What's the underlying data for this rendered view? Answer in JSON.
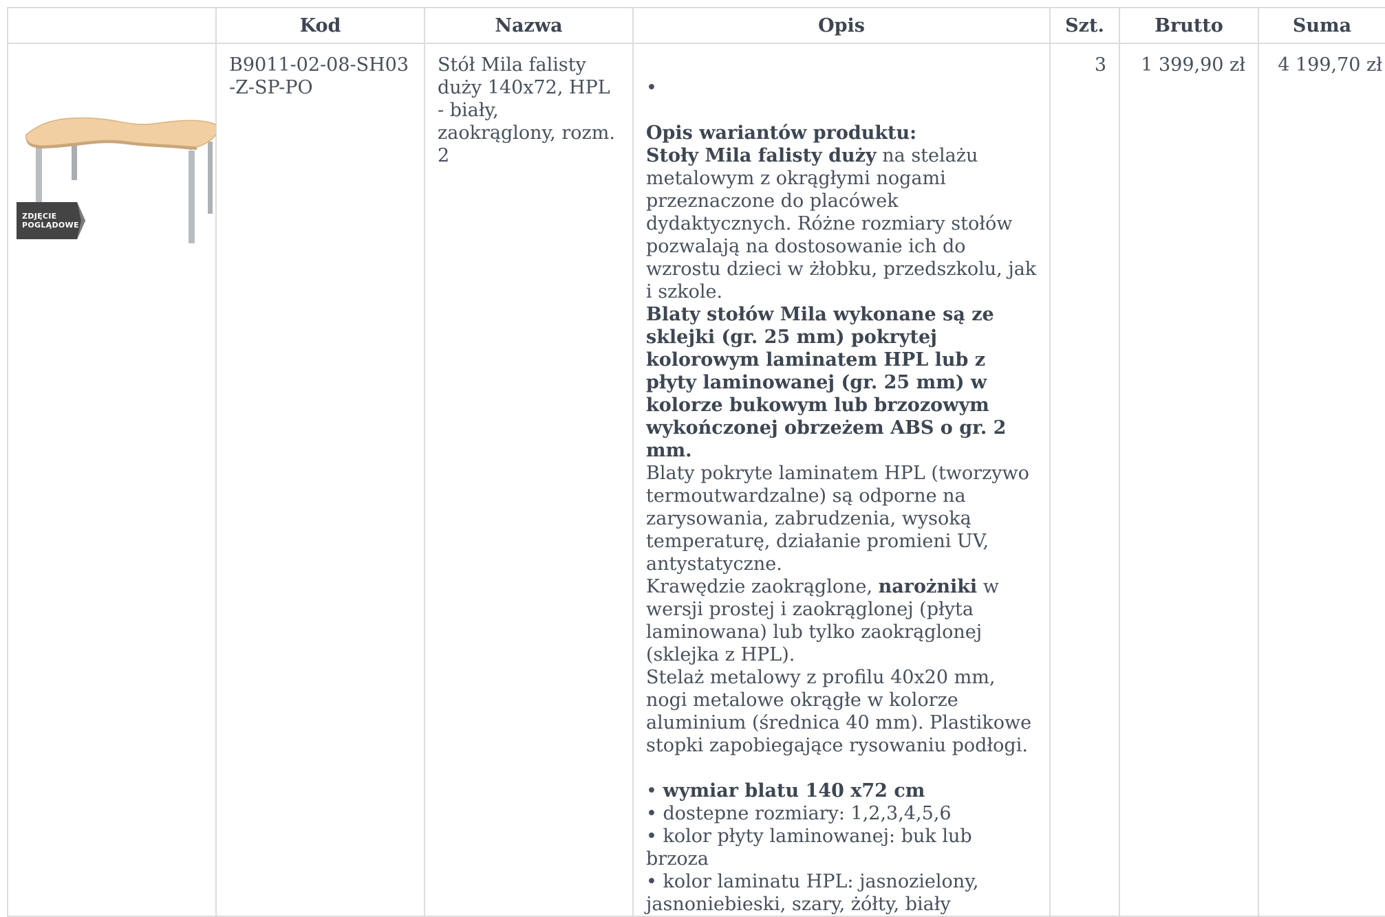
{
  "table": {
    "headers": [
      "",
      "Kod",
      "Nazwa",
      "Opis",
      "Szt.",
      "Brutto",
      "Suma"
    ],
    "row": {
      "image_badge": [
        "ZDJĘCIE",
        "POGLĄDOWE"
      ],
      "code": "B9011-02-08-SH03-Z-SP-PO",
      "name": "Stół Mila falisty duży 140x72, HPL - biały, zaokrąglony, rozm. 2",
      "qty": "3",
      "gross": "1 399,90 zł",
      "total": "4 199,70 zł"
    }
  },
  "description": {
    "lone_bullet": "•",
    "variants_heading": "Opis wariantów produktu:",
    "intro_bold": "Stoły Mila falisty duży",
    "intro_rest": " na stelażu metalowym z okrągłymi nogami przeznaczone do placówek dydaktycznych. Różne rozmiary stołów pozwalają na dostosowanie ich do wzrostu dzieci w żłobku, przedszkolu, jak i szkole.",
    "tops_bold": "Blaty stołów Mila wykonane są ze sklejki (gr. 25 mm) pokrytej kolorowym laminatem HPL lub z płyty laminowanej (gr. 25 mm) w kolorze bukowym lub brzozowym wykończonej obrzeżem ABS o gr. 2 mm.",
    "hpl_text": "Blaty pokryte laminatem HPL (tworzywo termoutwardzalne) są odporne na zarysowania, zabrudzenia, wysoką temperaturę, działanie promieni UV, antystatyczne.",
    "edges_pre": "Krawędzie zaokrąglone, ",
    "edges_bold": "narożniki",
    "edges_post": " w wersji prostej i zaokrąglonej (płyta laminowana) lub tylko zaokrąglonej (sklejka z HPL).",
    "frame_text": "Stelaż metalowy z profilu 40x20 mm, nogi metalowe okrągłe w kolorze aluminium (średnica 40 mm). Plastikowe stopki zapobiegające rysowaniu podłogi.",
    "bullet_sym": "• ",
    "bullet_size_bold": "wymiar blatu 140 x72 cm",
    "bullets": [
      "• dostepne rozmiary: 1,2,3,4,5,6",
      "• kolor płyty laminowanej: buk lub brzoza",
      "• kolor laminatu HPL: jasnozielony, jasnoniebieski, szary, żółty, biały"
    ]
  },
  "colors": {
    "text": "#47505c",
    "border": "#dcdcdc",
    "tabletop": "#f2cfa3",
    "legs": "#b9bcc0",
    "badge": "#444444"
  }
}
